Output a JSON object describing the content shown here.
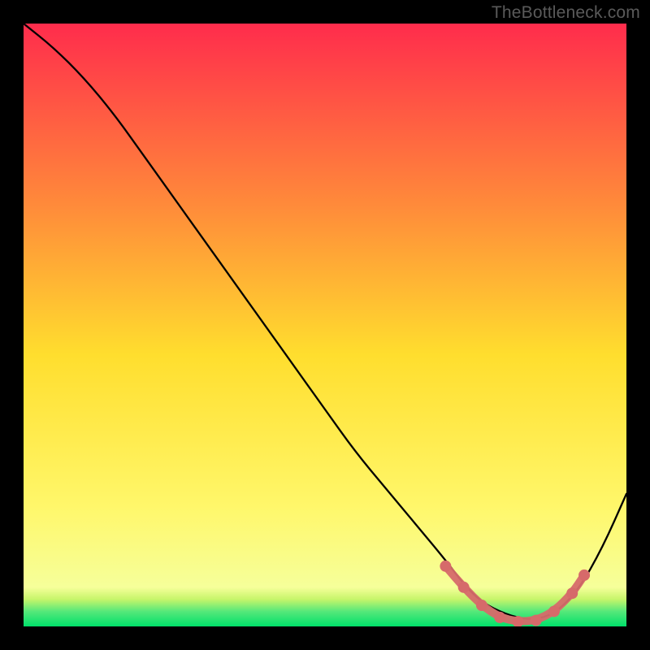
{
  "watermark": "TheBottleneck.com",
  "colors": {
    "frame": "#000000",
    "gradient_top": "#ff2c4c",
    "gradient_mid_upper": "#ff8a3a",
    "gradient_mid": "#ffde2e",
    "gradient_lower": "#fff76a",
    "gradient_bottom": "#00e06a",
    "curve": "#000000",
    "marker": "#d66a6a"
  },
  "chart_data": {
    "type": "line",
    "title": "",
    "xlabel": "",
    "ylabel": "",
    "xlim": [
      0,
      100
    ],
    "ylim": [
      0,
      100
    ],
    "series": [
      {
        "name": "bottleneck-curve",
        "x": [
          0,
          5,
          10,
          15,
          20,
          25,
          30,
          35,
          40,
          45,
          50,
          55,
          60,
          65,
          70,
          73,
          76,
          80,
          84,
          88,
          92,
          96,
          100
        ],
        "y": [
          100,
          96,
          91,
          85,
          78,
          71,
          64,
          57,
          50,
          43,
          36,
          29,
          23,
          17,
          11,
          7,
          4,
          2,
          1,
          2,
          6,
          13,
          22
        ]
      }
    ],
    "highlight": {
      "name": "optimal-range",
      "points": [
        {
          "x": 70,
          "y": 10
        },
        {
          "x": 73,
          "y": 6.5
        },
        {
          "x": 76,
          "y": 3.5
        },
        {
          "x": 79,
          "y": 1.5
        },
        {
          "x": 82,
          "y": 0.8
        },
        {
          "x": 85,
          "y": 1.0
        },
        {
          "x": 88,
          "y": 2.5
        },
        {
          "x": 91,
          "y": 5.5
        },
        {
          "x": 93,
          "y": 8.5
        }
      ]
    }
  }
}
